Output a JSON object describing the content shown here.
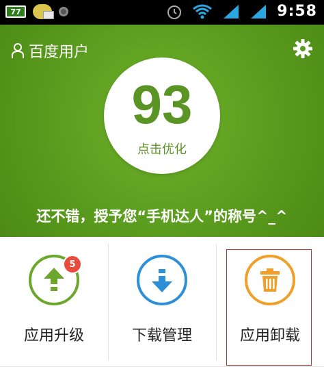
{
  "status_bar": {
    "battery_text": "77",
    "time": "9:58",
    "icons": [
      "battery-icon",
      "mail-icon",
      "record-icon",
      "alarm-clock-icon",
      "wifi-icon",
      "signal-icon"
    ]
  },
  "header": {
    "user_label": "百度用户",
    "settings_icon": "gear-icon"
  },
  "score": {
    "value": "93",
    "action_label": "点击优化"
  },
  "slogan": "还不错，授予您“手机达人”的称号^_^",
  "tiles": [
    {
      "label": "应用升级",
      "icon": "upload-arrow-icon",
      "badge": "5",
      "color": "#6aa72c"
    },
    {
      "label": "下载管理",
      "icon": "download-arrow-icon",
      "color": "#2e8fd8"
    },
    {
      "label": "应用卸载",
      "icon": "trash-icon",
      "color": "#f0a02a"
    }
  ],
  "colors": {
    "hero_green": "#5a9c1e",
    "score_green": "#5a9424",
    "badge_red": "#e84c3d"
  }
}
